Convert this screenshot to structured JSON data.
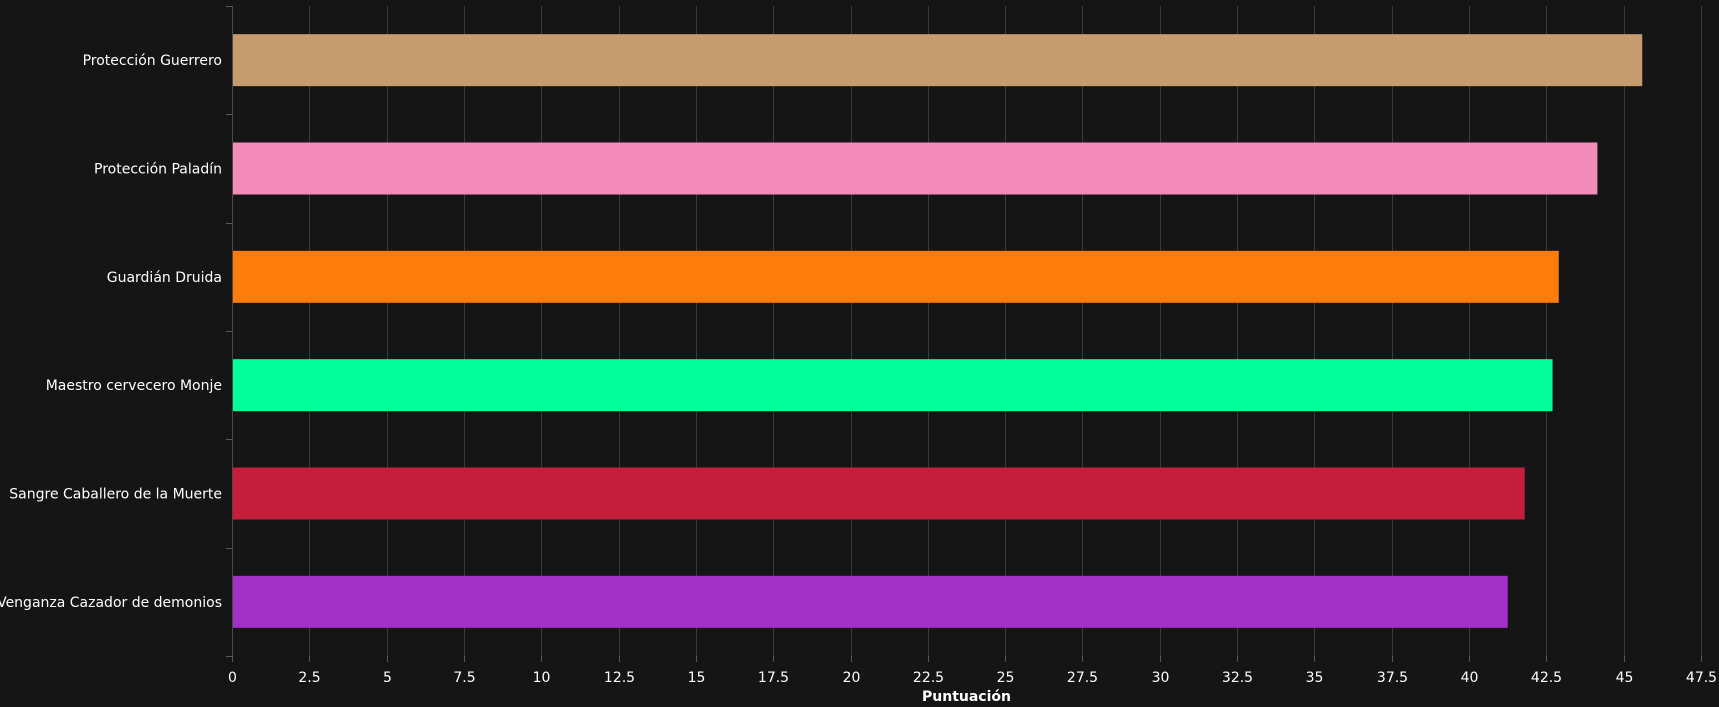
{
  "chart_data": {
    "type": "bar",
    "orientation": "horizontal",
    "categories": [
      "Protección Guerrero",
      "Protección Paladín",
      "Guardián Druida",
      "Maestro cervecero Monje",
      "Sangre Caballero de la Muerte",
      "Venganza Cazador de demonios"
    ],
    "values": [
      45.6,
      44.15,
      42.9,
      42.7,
      41.8,
      41.25
    ],
    "colors": [
      "#c69b6d",
      "#f48cba",
      "#ff7c0a",
      "#00ff98",
      "#c41e3a",
      "#a330c9"
    ],
    "xlabel": "Puntuación",
    "ylabel": "",
    "xlim": [
      0,
      47.5
    ],
    "xticks": [
      "0",
      "2.5",
      "5",
      "7.5",
      "10",
      "12.5",
      "15",
      "17.5",
      "20",
      "22.5",
      "25",
      "27.5",
      "30",
      "32.5",
      "35",
      "37.5",
      "40",
      "42.5",
      "45",
      "47.5"
    ],
    "grid": true,
    "legend": "none",
    "background": "#151515"
  }
}
